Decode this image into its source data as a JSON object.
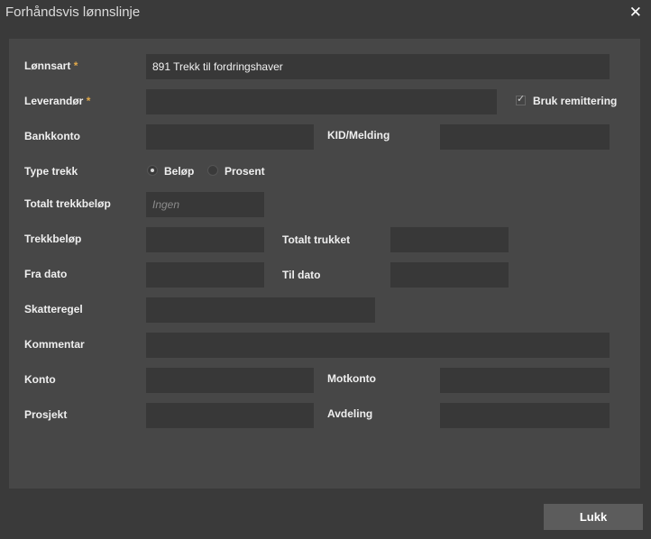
{
  "dialog": {
    "title": "Forhåndsvis lønnslinje",
    "close_icon": "✕",
    "close_button_label": "Lukk"
  },
  "form": {
    "lonnsart": {
      "label": "Lønnsart",
      "required": "*",
      "value": "891 Trekk til fordringshaver"
    },
    "leverandor": {
      "label": "Leverandør",
      "required": "*",
      "value": ""
    },
    "bruk_remittering": {
      "label": "Bruk remittering",
      "checked": true,
      "check_glyph": "✓"
    },
    "bankkonto": {
      "label": "Bankkonto",
      "value": ""
    },
    "kid_melding": {
      "label": "KID/Melding",
      "value": ""
    },
    "type_trekk": {
      "label": "Type trekk",
      "options": [
        {
          "label": "Beløp",
          "selected": true
        },
        {
          "label": "Prosent",
          "selected": false
        }
      ]
    },
    "totalt_trekkbelop": {
      "label": "Totalt trekkbeløp",
      "placeholder": "Ingen",
      "value": ""
    },
    "trekkbelop": {
      "label": "Trekkbeløp",
      "value": ""
    },
    "totalt_trukket": {
      "label": "Totalt trukket",
      "value": ""
    },
    "fra_dato": {
      "label": "Fra dato",
      "value": ""
    },
    "til_dato": {
      "label": "Til dato",
      "value": ""
    },
    "skatteregel": {
      "label": "Skatteregel",
      "value": ""
    },
    "kommentar": {
      "label": "Kommentar",
      "value": ""
    },
    "konto": {
      "label": "Konto",
      "value": ""
    },
    "motkonto": {
      "label": "Motkonto",
      "value": ""
    },
    "prosjekt": {
      "label": "Prosjekt",
      "value": ""
    },
    "avdeling": {
      "label": "Avdeling",
      "value": ""
    }
  },
  "colors": {
    "background": "#3a3a3a",
    "panel": "#474747",
    "field": "#383838",
    "required_asterisk": "#e0a84a",
    "button": "#5c5c5c"
  }
}
